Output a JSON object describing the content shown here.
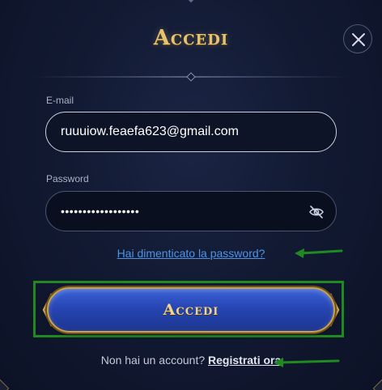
{
  "dialog": {
    "title": "Accedi",
    "close_icon": "close-icon"
  },
  "email": {
    "label": "E-mail",
    "value": "ruuuiow.feaefa623@gmail.com"
  },
  "password": {
    "label": "Password",
    "masked_value": "••••••••••••••••••",
    "toggle_icon": "eye-off-icon"
  },
  "forgot_password": {
    "label": "Hai dimenticato la password?"
  },
  "submit": {
    "label": "Accedi"
  },
  "register": {
    "prompt": "Non hai un account?",
    "link": "Registrati ora"
  },
  "colors": {
    "title_gold": "#e6c36f",
    "button_blue": "#2745b3",
    "link_blue": "#4f93e6",
    "annotation_green": "#1f8a1f"
  }
}
